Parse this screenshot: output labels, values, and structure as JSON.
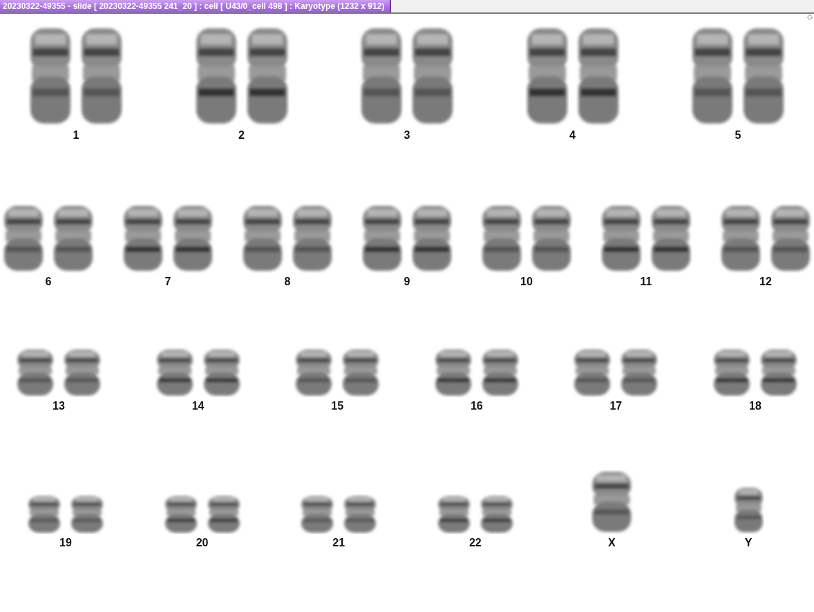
{
  "window": {
    "title": "20230322-49355 - slide [ 20230322-49355 241_20 ] : cell [ U43/0_cell 498 ] : Karyotype  (1232 x 912)"
  },
  "karyotype": {
    "rows": [
      {
        "groups": [
          {
            "label": "1",
            "kind": "pair"
          },
          {
            "label": "2",
            "kind": "pair"
          },
          {
            "label": "3",
            "kind": "pair"
          },
          {
            "label": "4",
            "kind": "pair"
          },
          {
            "label": "5",
            "kind": "pair"
          }
        ]
      },
      {
        "groups": [
          {
            "label": "6",
            "kind": "pair"
          },
          {
            "label": "7",
            "kind": "pair"
          },
          {
            "label": "8",
            "kind": "pair"
          },
          {
            "label": "9",
            "kind": "pair"
          },
          {
            "label": "10",
            "kind": "pair"
          },
          {
            "label": "11",
            "kind": "pair"
          },
          {
            "label": "12",
            "kind": "pair"
          }
        ]
      },
      {
        "groups": [
          {
            "label": "13",
            "kind": "pair"
          },
          {
            "label": "14",
            "kind": "pair"
          },
          {
            "label": "15",
            "kind": "pair"
          },
          {
            "label": "16",
            "kind": "pair"
          },
          {
            "label": "17",
            "kind": "pair"
          },
          {
            "label": "18",
            "kind": "pair"
          }
        ]
      },
      {
        "groups": [
          {
            "label": "19",
            "kind": "pair"
          },
          {
            "label": "20",
            "kind": "pair"
          },
          {
            "label": "21",
            "kind": "pair"
          },
          {
            "label": "22",
            "kind": "pair"
          },
          {
            "label": "X",
            "kind": "single"
          },
          {
            "label": "Y",
            "kind": "single"
          }
        ]
      }
    ]
  }
}
